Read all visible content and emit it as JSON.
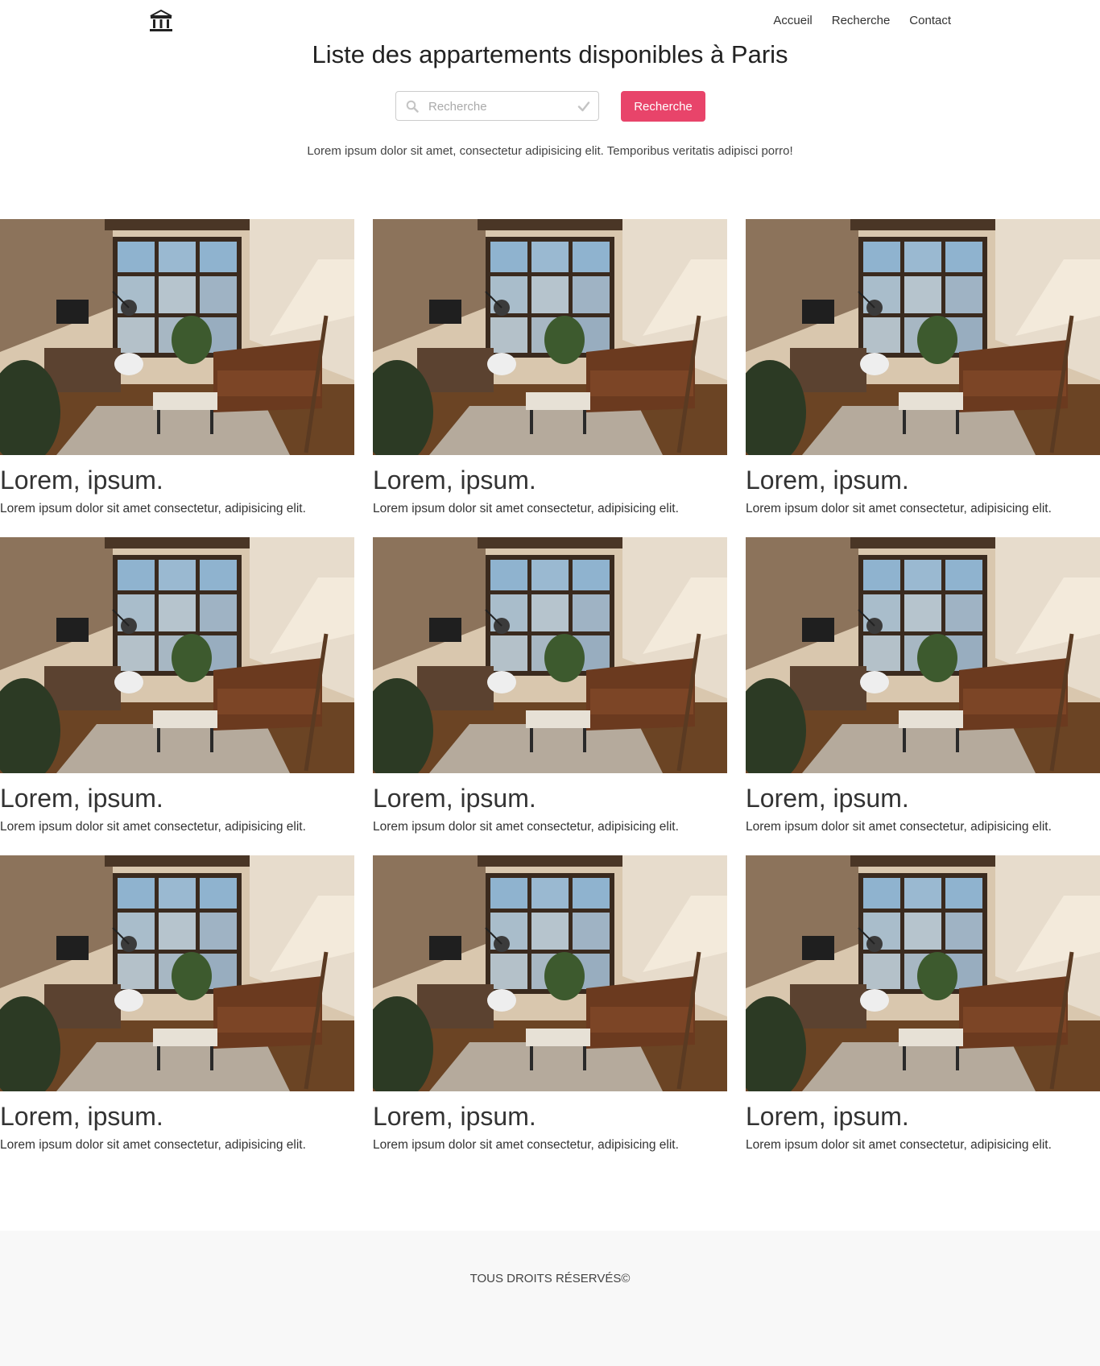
{
  "header": {
    "logo_icon": "building-columns-icon",
    "nav": [
      {
        "label": "Accueil"
      },
      {
        "label": "Recherche"
      },
      {
        "label": "Contact"
      }
    ]
  },
  "title": "Liste des appartements disponibles à Paris",
  "search": {
    "placeholder": "Recherche",
    "value": "",
    "button_label": "Recherche",
    "button_color": "#e8446a"
  },
  "intro": "Lorem ipsum dolor sit amet, consectetur adipisicing elit. Temporibus veritatis adipisci porro!",
  "listings": [
    {
      "title": "Lorem, ipsum.",
      "text": "Lorem ipsum dolor sit amet consectetur, adipisicing elit."
    },
    {
      "title": "Lorem, ipsum.",
      "text": "Lorem ipsum dolor sit amet consectetur, adipisicing elit."
    },
    {
      "title": "Lorem, ipsum.",
      "text": "Lorem ipsum dolor sit amet consectetur, adipisicing elit."
    },
    {
      "title": "Lorem, ipsum.",
      "text": "Lorem ipsum dolor sit amet consectetur, adipisicing elit."
    },
    {
      "title": "Lorem, ipsum.",
      "text": "Lorem ipsum dolor sit amet consectetur, adipisicing elit."
    },
    {
      "title": "Lorem, ipsum.",
      "text": "Lorem ipsum dolor sit amet consectetur, adipisicing elit."
    },
    {
      "title": "Lorem, ipsum.",
      "text": "Lorem ipsum dolor sit amet consectetur, adipisicing elit."
    },
    {
      "title": "Lorem, ipsum.",
      "text": "Lorem ipsum dolor sit amet consectetur, adipisicing elit."
    },
    {
      "title": "Lorem, ipsum.",
      "text": "Lorem ipsum dolor sit amet consectetur, adipisicing elit."
    }
  ],
  "footer": {
    "text": "TOUS DROITS RÉSERVÉS©"
  }
}
